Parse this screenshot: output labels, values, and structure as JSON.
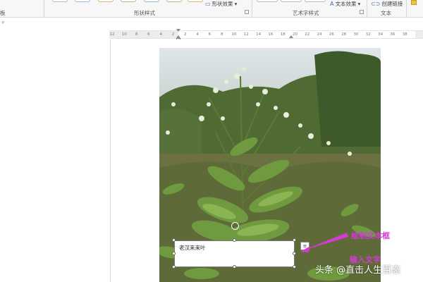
{
  "ribbon": {
    "partial_left_label": "板",
    "shape_styles_label": "形状样式",
    "shape_effects_label": "形状效果",
    "art_styles_label": "艺术字样式",
    "text_effects_label": "文本效果",
    "create_link_label": "创建链接",
    "text_group_label": "文本"
  },
  "quick_access": {
    "pin_glyph": "ᵖ"
  },
  "ruler": {
    "numbers": [
      "12",
      "10",
      "8",
      "6",
      "4",
      "2",
      "2",
      "4",
      "6",
      "8",
      "10",
      "12",
      "14",
      "16",
      "18",
      "20",
      "22",
      "24",
      "26",
      "28",
      "30",
      "32",
      "34",
      "36",
      "38"
    ]
  },
  "textbox": {
    "text": "老汉来来叶"
  },
  "annotations": {
    "draw_textbox": "绘制文本框",
    "input_text": "输入文字"
  },
  "watermark": {
    "text": "头条 @直击人生百态"
  },
  "colors": {
    "annotation": "#d63ad6",
    "ribbon_bg": "#f7f7f7"
  }
}
